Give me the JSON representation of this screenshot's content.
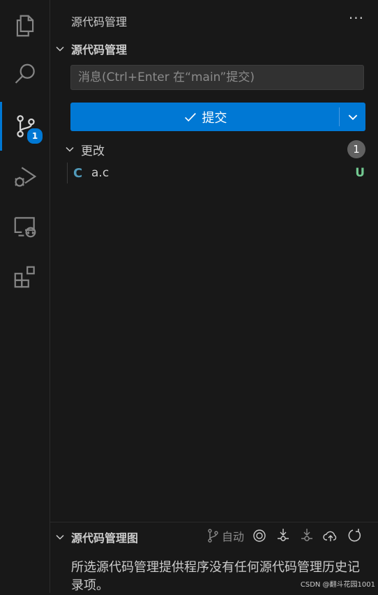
{
  "activity_bar": {
    "items": [
      {
        "name": "explorer-icon"
      },
      {
        "name": "search-icon"
      },
      {
        "name": "source-control-icon",
        "badge": "1"
      },
      {
        "name": "run-debug-icon"
      },
      {
        "name": "remote-explorer-icon"
      },
      {
        "name": "extensions-icon"
      }
    ],
    "accent_color": "#0078d4"
  },
  "sidebar": {
    "title": "源代码管理",
    "more_label": "···"
  },
  "scm": {
    "section_title": "源代码管理",
    "message_placeholder": "消息(Ctrl+Enter 在“main”提交)",
    "commit_label": "提交",
    "changes": {
      "label": "更改",
      "count": "1",
      "files": [
        {
          "icon_letter": "C",
          "name": "a.c",
          "status": "U"
        }
      ]
    }
  },
  "graph": {
    "title": "源代码管理图",
    "auto_label": "自动",
    "empty_message": "所选源代码管理提供程序没有任何源代码管理历史记录项。"
  },
  "watermark": "CSDN @翻斗花园1001"
}
